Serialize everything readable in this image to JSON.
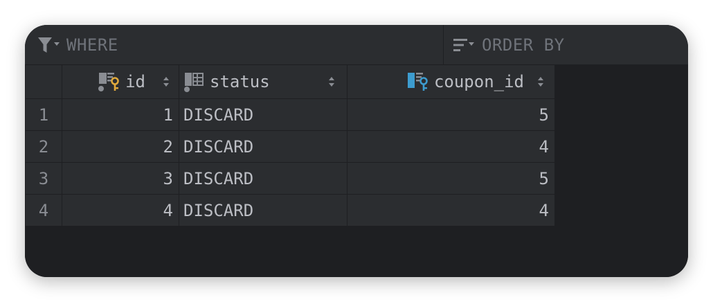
{
  "filter": {
    "where_label": "WHERE",
    "order_label": "ORDER BY"
  },
  "columns": [
    {
      "name": "id",
      "icon": "primary-key-column-icon"
    },
    {
      "name": "status",
      "icon": "column-icon"
    },
    {
      "name": "coupon_id",
      "icon": "foreign-key-column-icon"
    }
  ],
  "rows": [
    {
      "num": "1",
      "id": "1",
      "status": "DISCARD",
      "coupon_id": "5"
    },
    {
      "num": "2",
      "id": "2",
      "status": "DISCARD",
      "coupon_id": "4"
    },
    {
      "num": "3",
      "id": "3",
      "status": "DISCARD",
      "coupon_id": "5"
    },
    {
      "num": "4",
      "id": "4",
      "status": "DISCARD",
      "coupon_id": "4"
    }
  ],
  "colors": {
    "background": "#1e1f22",
    "panel": "#2b2d30",
    "text": "#bcbec4",
    "muted": "#6f737a",
    "primary_key": "#e0a93c",
    "foreign_key": "#3d9ccf"
  }
}
